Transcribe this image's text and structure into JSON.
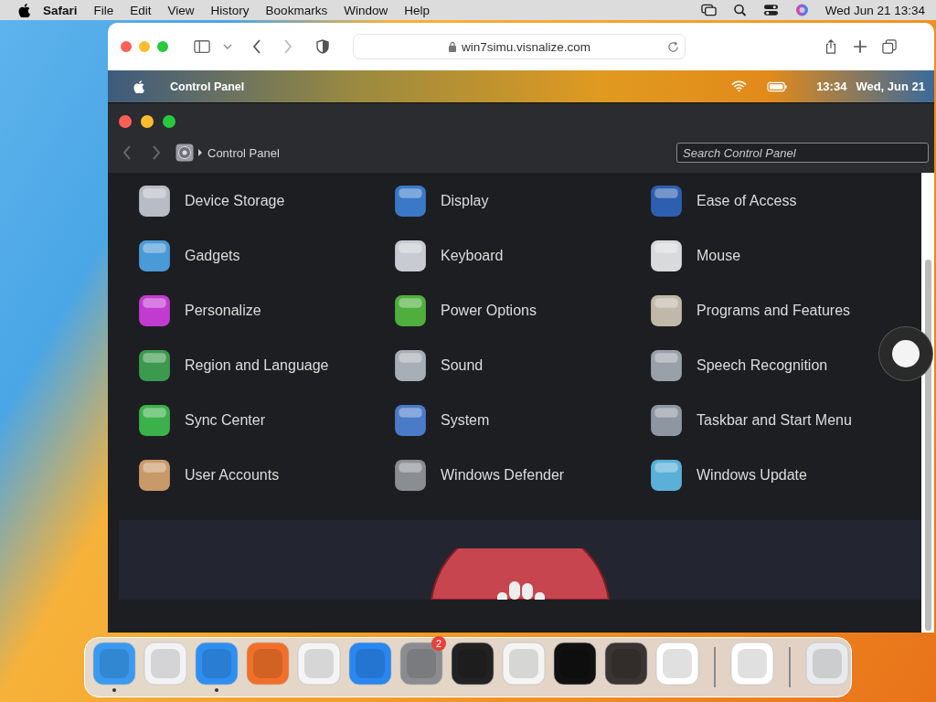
{
  "menu_bar": {
    "app": "Safari",
    "menus": [
      "File",
      "Edit",
      "View",
      "History",
      "Bookmarks",
      "Window",
      "Help"
    ],
    "clock": "Wed Jun 21  13:34"
  },
  "browser": {
    "url": "win7simu.visnalize.com"
  },
  "sim_bar": {
    "title": "Control Panel",
    "time": "13:34",
    "date": "Wed, Jun 21"
  },
  "control_panel": {
    "breadcrumb": "Control Panel",
    "search": {
      "placeholder": "Search Control Panel"
    },
    "items": [
      {
        "label": "Device Storage",
        "color": "#b8bcc4"
      },
      {
        "label": "Display",
        "color": "#3a78c8"
      },
      {
        "label": "Ease of Access",
        "color": "#2d5fb0"
      },
      {
        "label": "Gadgets",
        "color": "#4a9ad8"
      },
      {
        "label": "Keyboard",
        "color": "#c8ccd2"
      },
      {
        "label": "Mouse",
        "color": "#d8dadc"
      },
      {
        "label": "Personalize",
        "color": "#c23bd0"
      },
      {
        "label": "Power Options",
        "color": "#4fae3c"
      },
      {
        "label": "Programs and Features",
        "color": "#c0b8a8"
      },
      {
        "label": "Region and Language",
        "color": "#3c9a4e"
      },
      {
        "label": "Sound",
        "color": "#a8aeb6"
      },
      {
        "label": "Speech Recognition",
        "color": "#9aa0a8"
      },
      {
        "label": "Sync Center",
        "color": "#3cb04a"
      },
      {
        "label": "System",
        "color": "#4a7ac8"
      },
      {
        "label": "Taskbar and Start Menu",
        "color": "#8e96a2"
      },
      {
        "label": "User Accounts",
        "color": "#c89a6a"
      },
      {
        "label": "Windows Defender",
        "color": "#8a8e92"
      },
      {
        "label": "Windows Update",
        "color": "#5ab0d8"
      }
    ]
  },
  "dock": [
    {
      "color": "#3a9af0",
      "running": true,
      "separator_after": false
    },
    {
      "color": "#f2f2f4",
      "running": false,
      "separator_after": false
    },
    {
      "color": "#2f8ff0",
      "running": true,
      "separator_after": false
    },
    {
      "color": "#f0702a",
      "running": false,
      "separator_after": false
    },
    {
      "color": "#f4f4f4",
      "running": false,
      "separator_after": false
    },
    {
      "color": "#2a86f0",
      "running": false,
      "separator_after": false
    },
    {
      "color": "#8a8c90",
      "running": false,
      "separator_after": false,
      "badge": "2"
    },
    {
      "color": "#222222",
      "running": false,
      "separator_after": false
    },
    {
      "color": "#f4f4f2",
      "running": false,
      "separator_after": false
    },
    {
      "color": "#111111",
      "running": false,
      "separator_after": false
    },
    {
      "color": "#3a3432",
      "running": false,
      "separator_after": false
    },
    {
      "color": "#ffffff",
      "running": false,
      "separator_after": true
    },
    {
      "color": "#ffffff",
      "running": false,
      "separator_after": true
    },
    {
      "color": "#e8eaec",
      "running": false,
      "separator_after": false
    }
  ]
}
